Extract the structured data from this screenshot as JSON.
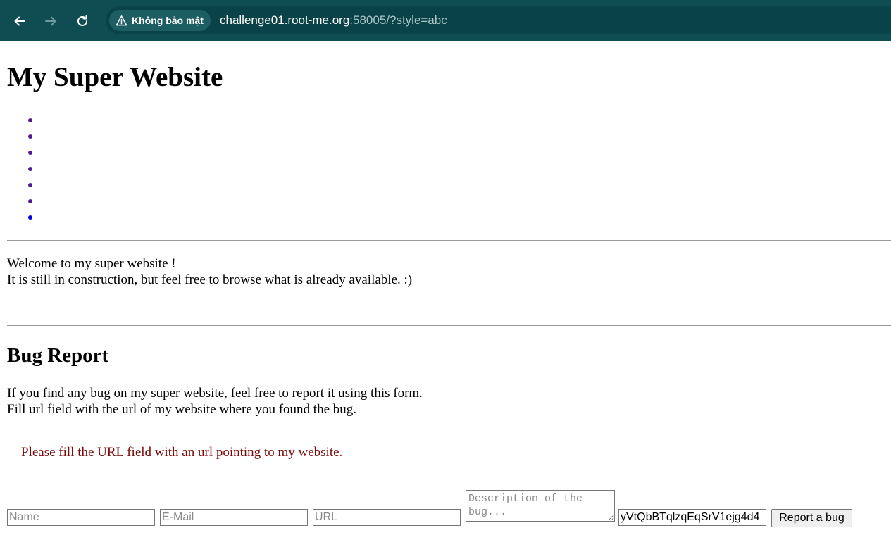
{
  "browser": {
    "back_icon": "arrow-left-icon",
    "forward_icon": "arrow-right-icon",
    "reload_icon": "reload-icon",
    "security_label": "Không bảo mật",
    "url_host": "challenge01.root-me.org",
    "url_rest": ":58005/?style=abc",
    "colors": {
      "toolbar": "#0f4d52",
      "omnibox": "#0a4347"
    }
  },
  "page": {
    "title": "My Super Website",
    "menu_items_count_visible": 7,
    "welcome_line1": "Welcome to my super website !",
    "welcome_line2": "It is still in construction, but feel free to browse what is already available. :)",
    "bug_report": {
      "heading": "Bug Report",
      "intro_line1": "If you find any bug on my super website, feel free to report it using this form.",
      "intro_line2": "Fill url field with the url of my website where you found the bug.",
      "error_message": "Please fill the URL field with an url pointing to my website.",
      "name_placeholder": "Name",
      "email_placeholder": "E-Mail",
      "url_placeholder": "URL",
      "description_placeholder": "Description of the bug...",
      "token_value": "yVtQbBTqlzqEqSrV1ejg4d4",
      "submit_label": "Report a bug"
    },
    "colors": {
      "visited_bullet": "#551a8b",
      "unvisited_bullet": "#0000ee",
      "error_text": "#7b0b0b"
    }
  }
}
